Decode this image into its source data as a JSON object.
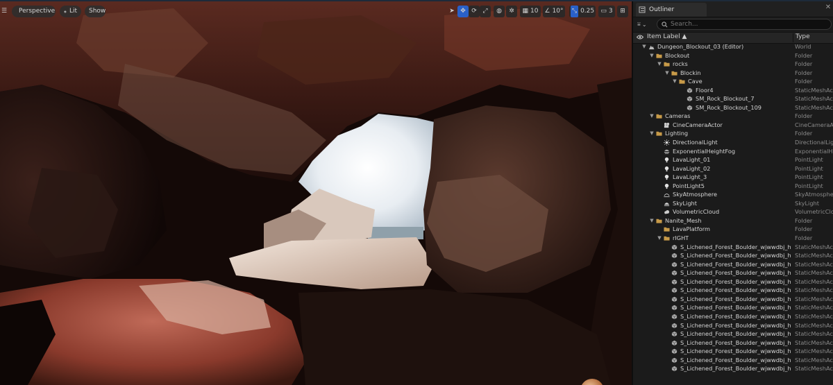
{
  "viewport": {
    "perspective_label": "Perspective",
    "lit_label": "Lit",
    "show_label": "Show",
    "grid_snap_value": "10",
    "rotation_snap_value": "10°",
    "scale_snap_value": "0.25",
    "camera_speed_value": "3"
  },
  "outliner": {
    "tab_label": "Outliner",
    "close_glyph": "✕",
    "search_placeholder": "Search...",
    "col_item_label": "Item Label ▲",
    "col_type": "Type",
    "rows": [
      {
        "label": "Dungeon_Blockout_03 (Editor)",
        "type": "World",
        "indent": 0,
        "expand": "open",
        "icon": "world-icon"
      },
      {
        "label": "Blockout",
        "type": "Folder",
        "indent": 1,
        "expand": "open",
        "icon": "folder-icon"
      },
      {
        "label": "rocks",
        "type": "Folder",
        "indent": 2,
        "expand": "open",
        "icon": "folder-icon"
      },
      {
        "label": "Blockin",
        "type": "Folder",
        "indent": 3,
        "expand": "open",
        "icon": "folder-icon"
      },
      {
        "label": "Cave",
        "type": "Folder",
        "indent": 4,
        "expand": "open",
        "icon": "folder-icon"
      },
      {
        "label": "Floor4",
        "type": "StaticMeshActor",
        "indent": 5,
        "expand": "none",
        "icon": "static-mesh-icon"
      },
      {
        "label": "SM_Rock_Blockout_7",
        "type": "StaticMeshActor",
        "indent": 5,
        "expand": "none",
        "icon": "static-mesh-icon"
      },
      {
        "label": "SM_Rock_Blockout_109",
        "type": "StaticMeshActor",
        "indent": 5,
        "expand": "none",
        "icon": "static-mesh-icon"
      },
      {
        "label": "Cameras",
        "type": "Folder",
        "indent": 1,
        "expand": "open",
        "icon": "folder-icon"
      },
      {
        "label": "CineCameraActor",
        "type": "CineCameraActor",
        "indent": 2,
        "expand": "none",
        "icon": "camera-icon"
      },
      {
        "label": "Lighting",
        "type": "Folder",
        "indent": 1,
        "expand": "open",
        "icon": "folder-icon"
      },
      {
        "label": "DirectionalLight",
        "type": "DirectionalLight",
        "indent": 2,
        "expand": "none",
        "icon": "directional-light-icon"
      },
      {
        "label": "ExponentialHeightFog",
        "type": "ExponentialHeightFog",
        "indent": 2,
        "expand": "none",
        "icon": "fog-icon"
      },
      {
        "label": "LavaLight_01",
        "type": "PointLight",
        "indent": 2,
        "expand": "none",
        "icon": "point-light-icon"
      },
      {
        "label": "LavaLight_02",
        "type": "PointLight",
        "indent": 2,
        "expand": "none",
        "icon": "point-light-icon"
      },
      {
        "label": "LavaLight_3",
        "type": "PointLight",
        "indent": 2,
        "expand": "none",
        "icon": "point-light-icon"
      },
      {
        "label": "PointLight5",
        "type": "PointLight",
        "indent": 2,
        "expand": "none",
        "icon": "point-light-icon"
      },
      {
        "label": "SkyAtmosphere",
        "type": "SkyAtmosphere",
        "indent": 2,
        "expand": "none",
        "icon": "sky-atmosphere-icon"
      },
      {
        "label": "SkyLight",
        "type": "SkyLight",
        "indent": 2,
        "expand": "none",
        "icon": "sky-light-icon"
      },
      {
        "label": "VolumetricCloud",
        "type": "VolumetricCloud",
        "indent": 2,
        "expand": "none",
        "icon": "cloud-icon"
      },
      {
        "label": "Nanite_Mesh",
        "type": "Folder",
        "indent": 1,
        "expand": "open",
        "icon": "folder-icon"
      },
      {
        "label": "LavaPlatform",
        "type": "Folder",
        "indent": 2,
        "expand": "none",
        "icon": "folder-icon"
      },
      {
        "label": "rIGHT",
        "type": "Folder",
        "indent": 2,
        "expand": "open",
        "icon": "folder-icon"
      },
      {
        "label": "S_Lichened_Forest_Boulder_wjwwdbj_high_V",
        "type": "StaticMeshActor",
        "indent": 3,
        "expand": "none",
        "icon": "static-mesh-icon"
      },
      {
        "label": "S_Lichened_Forest_Boulder_wjwwdbj_high_V",
        "type": "StaticMeshActor",
        "indent": 3,
        "expand": "none",
        "icon": "static-mesh-icon"
      },
      {
        "label": "S_Lichened_Forest_Boulder_wjwwdbj_high_V",
        "type": "StaticMeshActor",
        "indent": 3,
        "expand": "none",
        "icon": "static-mesh-icon"
      },
      {
        "label": "S_Lichened_Forest_Boulder_wjwwdbj_high_V",
        "type": "StaticMeshActor",
        "indent": 3,
        "expand": "none",
        "icon": "static-mesh-icon"
      },
      {
        "label": "S_Lichened_Forest_Boulder_wjwwdbj_high_V",
        "type": "StaticMeshActor",
        "indent": 3,
        "expand": "none",
        "icon": "static-mesh-icon"
      },
      {
        "label": "S_Lichened_Forest_Boulder_wjwwdbj_high_V",
        "type": "StaticMeshActor",
        "indent": 3,
        "expand": "none",
        "icon": "static-mesh-icon"
      },
      {
        "label": "S_Lichened_Forest_Boulder_wjwwdbj_high_V",
        "type": "StaticMeshActor",
        "indent": 3,
        "expand": "none",
        "icon": "static-mesh-icon"
      },
      {
        "label": "S_Lichened_Forest_Boulder_wjwwdbj_high_V",
        "type": "StaticMeshActor",
        "indent": 3,
        "expand": "none",
        "icon": "static-mesh-icon"
      },
      {
        "label": "S_Lichened_Forest_Boulder_wjwwdbj_high_V",
        "type": "StaticMeshActor",
        "indent": 3,
        "expand": "none",
        "icon": "static-mesh-icon"
      },
      {
        "label": "S_Lichened_Forest_Boulder_wjwwdbj_high_V",
        "type": "StaticMeshActor",
        "indent": 3,
        "expand": "none",
        "icon": "static-mesh-icon"
      },
      {
        "label": "S_Lichened_Forest_Boulder_wjwwdbj_high_V",
        "type": "StaticMeshActor",
        "indent": 3,
        "expand": "none",
        "icon": "static-mesh-icon"
      },
      {
        "label": "S_Lichened_Forest_Boulder_wjwwdbj_high_V",
        "type": "StaticMeshActor",
        "indent": 3,
        "expand": "none",
        "icon": "static-mesh-icon"
      },
      {
        "label": "S_Lichened_Forest_Boulder_wjwwdbj_high_V",
        "type": "StaticMeshActor",
        "indent": 3,
        "expand": "none",
        "icon": "static-mesh-icon"
      },
      {
        "label": "S_Lichened_Forest_Boulder_wjwwdbj_high_V",
        "type": "StaticMeshActor",
        "indent": 3,
        "expand": "none",
        "icon": "static-mesh-icon"
      },
      {
        "label": "S_Lichened_Forest_Boulder_wjwwdbj_high_V",
        "type": "StaticMeshActor",
        "indent": 3,
        "expand": "none",
        "icon": "static-mesh-icon"
      }
    ]
  },
  "colors": {
    "accent": "#2a60c8",
    "folder": "#c79a48",
    "panel_bg": "#1b1b1b"
  }
}
